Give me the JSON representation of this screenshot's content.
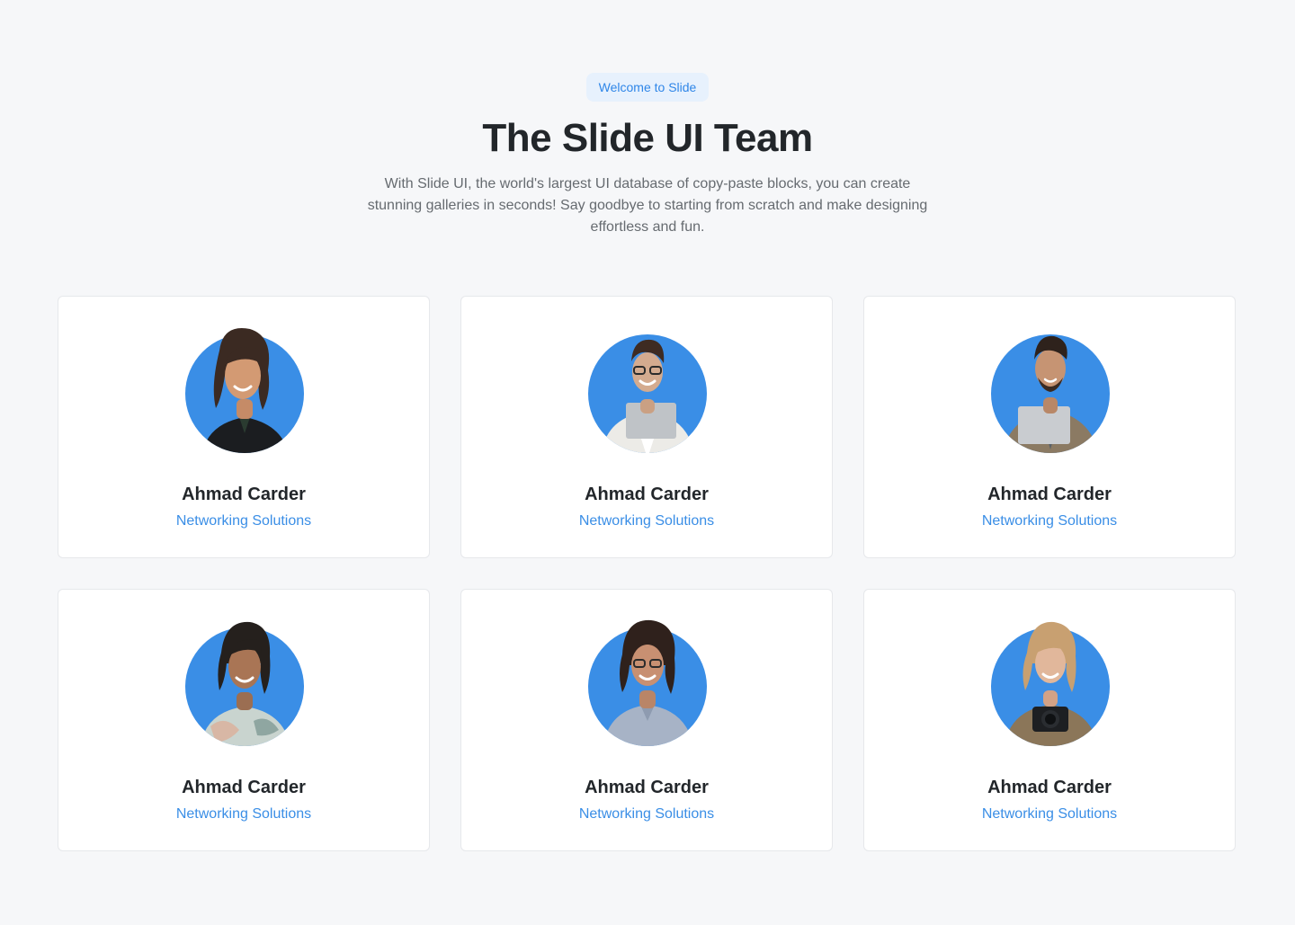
{
  "header": {
    "badge": "Welcome to Slide",
    "title": "The Slide UI Team",
    "description": "With Slide UI, the world's largest UI database of copy-paste blocks, you can create stunning galleries in seconds! Say goodbye to starting from scratch and make designing effortless and fun."
  },
  "colors": {
    "accent": "#2f86e8",
    "avatar_bg": "#3a8ee6"
  },
  "team": [
    {
      "name": "Ahmad Carder",
      "role": "Networking Solutions",
      "avatar": "woman-black-shirt"
    },
    {
      "name": "Ahmad Carder",
      "role": "Networking Solutions",
      "avatar": "man-glasses-laptop"
    },
    {
      "name": "Ahmad Carder",
      "role": "Networking Solutions",
      "avatar": "man-jacket-laptop"
    },
    {
      "name": "Ahmad Carder",
      "role": "Networking Solutions",
      "avatar": "woman-floral-shirt"
    },
    {
      "name": "Ahmad Carder",
      "role": "Networking Solutions",
      "avatar": "woman-glasses-blue-shirt"
    },
    {
      "name": "Ahmad Carder",
      "role": "Networking Solutions",
      "avatar": "woman-camera"
    }
  ]
}
